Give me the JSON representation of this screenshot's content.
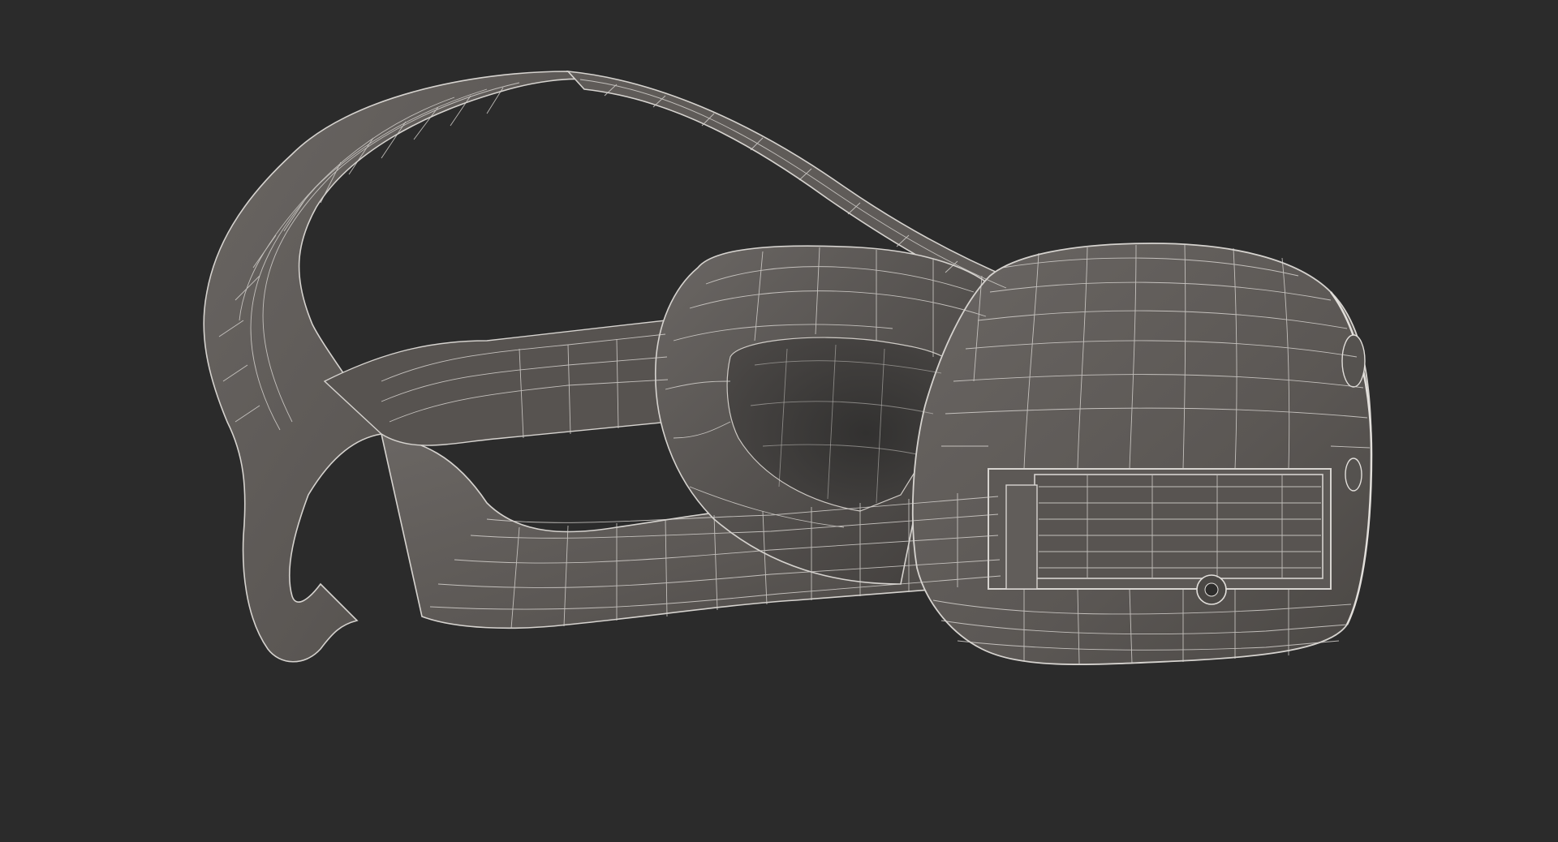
{
  "scene": {
    "subject": "vr-headset-wireframe",
    "background_color": "#2b2b2b",
    "surface_color": "#5e5a57",
    "shadow_color": "#4b4845",
    "wire_color": "#d6d3cf"
  }
}
